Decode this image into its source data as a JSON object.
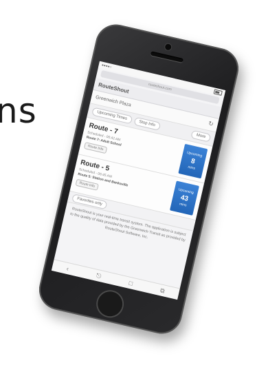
{
  "slide": {
    "partial_text": "ns"
  },
  "phone": {
    "url": "routeshout.com",
    "app": {
      "title": "RouteShout",
      "location": "Greenwich Plaza",
      "buttons": {
        "upcoming": "Upcoming Times",
        "stop_info": "Stop Info",
        "more": "More"
      },
      "routes": [
        {
          "title": "Route - 7",
          "line1": "Scheduled - 06:42 AM",
          "stop": "Route 7: Adult School",
          "badge": "Route Info",
          "tile_top": "Upcoming",
          "tile_num": "8",
          "tile_bottom": "mins"
        },
        {
          "title": "Route - 5",
          "line1": "Scheduled - 06:45 AM",
          "stop": "Route 5: Station and Banksville",
          "badge": "Route Info",
          "tile_top": "Upcoming",
          "tile_num": "43",
          "tile_bottom": "mins"
        }
      ],
      "toggle": "Favorites only",
      "disclaimer": "RouteShout is your real-time transit system. The application is subject to the quality of data provided by the Greenwich Transit as provided by RouteShout Software, Inc."
    },
    "toolbar": {
      "back": "‹",
      "share": "⎋",
      "bookmarks": "□",
      "tabs": "⧉"
    }
  }
}
